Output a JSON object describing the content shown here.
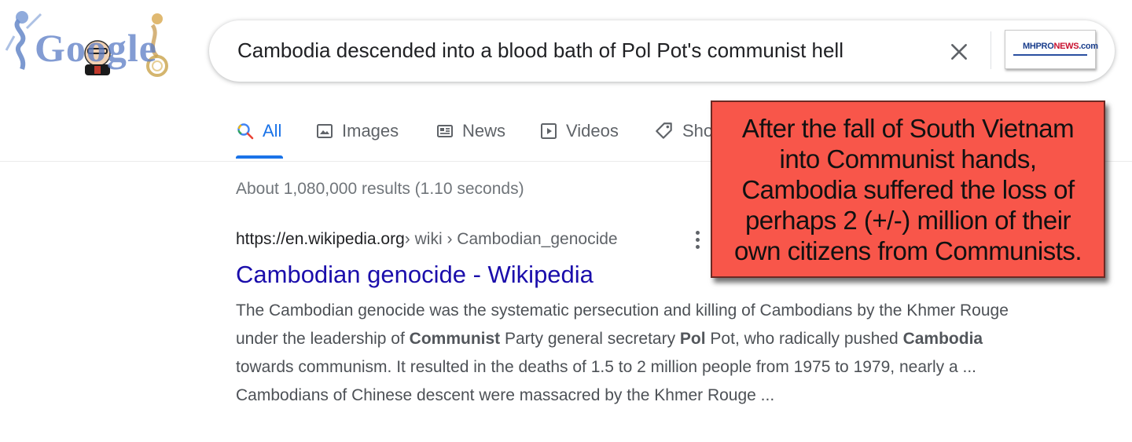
{
  "logo": {
    "text": "Google",
    "icon": "google-doodle-icon"
  },
  "search": {
    "query": "Cambodia descended into a blood bath of Pol Pot's communist hell",
    "clear_icon": "close-icon",
    "brand_thumbnail": {
      "logo_prefix": "MH",
      "logo_main": "PRO",
      "logo_suffix": "NEWS",
      "logo_domain": ".com"
    }
  },
  "tabs": [
    {
      "label": "All",
      "icon": "search-icon",
      "active": true
    },
    {
      "label": "Images",
      "icon": "image-icon",
      "active": false
    },
    {
      "label": "News",
      "icon": "news-icon",
      "active": false
    },
    {
      "label": "Videos",
      "icon": "play-icon",
      "active": false
    },
    {
      "label": "Sho",
      "icon": "tag-icon",
      "active": false
    }
  ],
  "results": {
    "stats": "About 1,080,000 results (1.10 seconds)",
    "items": [
      {
        "url": "https://en.wikipedia.org",
        "path": " › wiki › Cambodian_genocide",
        "title": "Cambodian genocide - Wikipedia",
        "snippet": [
          {
            "t": "The Cambodian genocide was the systematic persecution and killing of Cambodians by the Khmer Rouge under the leadership of "
          },
          {
            "t": "Communist",
            "b": true
          },
          {
            "t": " Party general secretary "
          },
          {
            "t": "Pol",
            "b": true
          },
          {
            "t": " Pot, who radically pushed "
          },
          {
            "t": "Cambodia",
            "b": true
          },
          {
            "t": " towards communism. It resulted in the deaths of 1.5 to 2 million people from 1975 to 1979, nearly a ... Cambodians of Chinese descent were massacred by the Khmer Rouge ..."
          }
        ]
      }
    ]
  },
  "callout": {
    "lines": [
      "After the fall of South Vietnam",
      "into Communist hands,",
      "Cambodia suffered the loss of",
      "perhaps 2 (+/-) million of their",
      "own citizens from Communists."
    ],
    "background": "#f8564a"
  },
  "colors": {
    "link": "#1a0dab",
    "accent": "#1a73e8",
    "text": "#4d5156"
  }
}
